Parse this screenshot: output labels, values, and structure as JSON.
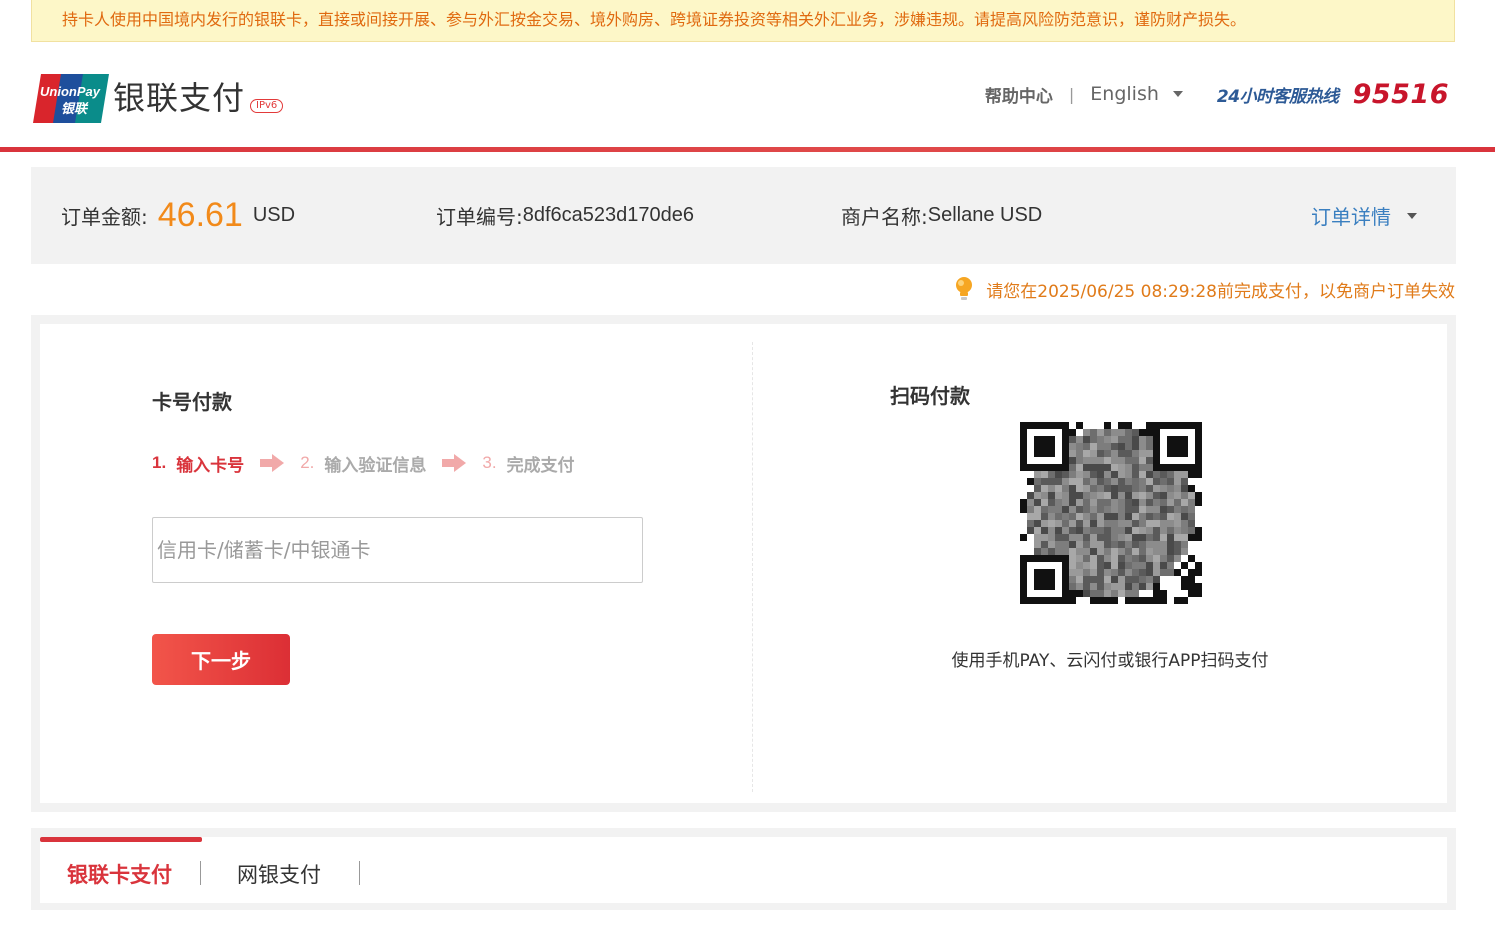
{
  "notice": {
    "text": "持卡人使用中国境内发行的银联卡，直接或间接开展、参与外汇按金交易、境外购房、跨境证券投资等相关外汇业务，涉嫌违规。请提高风险防范意识，谨防财产损失。"
  },
  "header": {
    "logo_mark_text_top": "UnionPay",
    "logo_mark_text_bottom": "银联",
    "logo_text": "银联支付",
    "ipv6_badge": "IPv6",
    "help_link": "帮助中心",
    "separator": "|",
    "language": "English",
    "hotline_label": "24小时客服热线",
    "hotline_number": "95516"
  },
  "order": {
    "amount_label": "订单金额:",
    "amount_value": "46.61",
    "amount_currency": "USD",
    "number_label": "订单编号:",
    "number_value": "8df6ca523d170de6",
    "merchant_label": "商户名称:",
    "merchant_value": "Sellane USD",
    "detail_link": "订单详情"
  },
  "deadline": {
    "text": "请您在2025/06/25 08:29:28前完成支付，以免商户订单失效"
  },
  "card_payment": {
    "title": "卡号付款",
    "steps": [
      {
        "num": "1.",
        "label": "输入卡号"
      },
      {
        "num": "2.",
        "label": "输入验证信息"
      },
      {
        "num": "3.",
        "label": "完成支付"
      }
    ],
    "card_input_placeholder": "信用卡/储蓄卡/中银通卡",
    "next_button": "下一步"
  },
  "qr_payment": {
    "title": "扫码付款",
    "caption": "使用手机PAY、云闪付或银行APP扫码支付"
  },
  "tabs": [
    {
      "label": "银联卡支付"
    },
    {
      "label": "网银支付"
    }
  ],
  "colors": {
    "brand_red": "#d9343c",
    "amount_orange": "#f28a1a",
    "link_blue": "#3a7fc0",
    "hotline_blue": "#2d5a96"
  }
}
